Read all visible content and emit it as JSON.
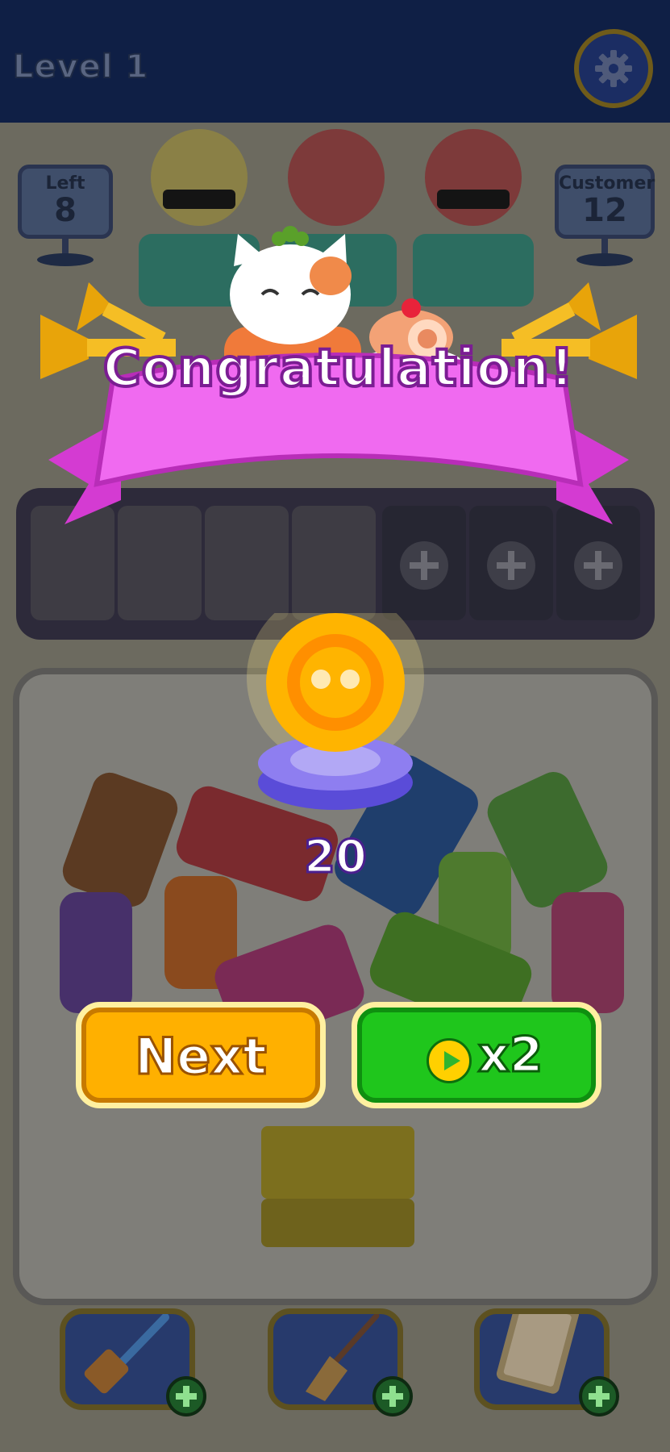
{
  "header": {
    "level_label": "Level 1",
    "settings_icon": "gear-icon"
  },
  "stats": {
    "left_label": "Left",
    "left_value": "8",
    "customer_label": "Customer",
    "customer_value": "12"
  },
  "slots": {
    "open_count": 4,
    "locked_count": 3,
    "locked_icon": "plus-icon"
  },
  "overlay": {
    "title": "Congratulation!",
    "reward_amount": "20",
    "reward_icon": "coin-icon",
    "next_label": "Next",
    "double_label": "x2",
    "double_icon": "play-video-icon"
  },
  "tools": [
    {
      "name": "spatula",
      "icon": "spatula-icon"
    },
    {
      "name": "broom",
      "icon": "broom-icon"
    },
    {
      "name": "order-list",
      "icon": "clipboard-icon"
    }
  ],
  "colors": {
    "banner": "#e24fe0",
    "next_button": "#ffb000",
    "double_button": "#1fc61c",
    "coin": "#ffb400"
  }
}
